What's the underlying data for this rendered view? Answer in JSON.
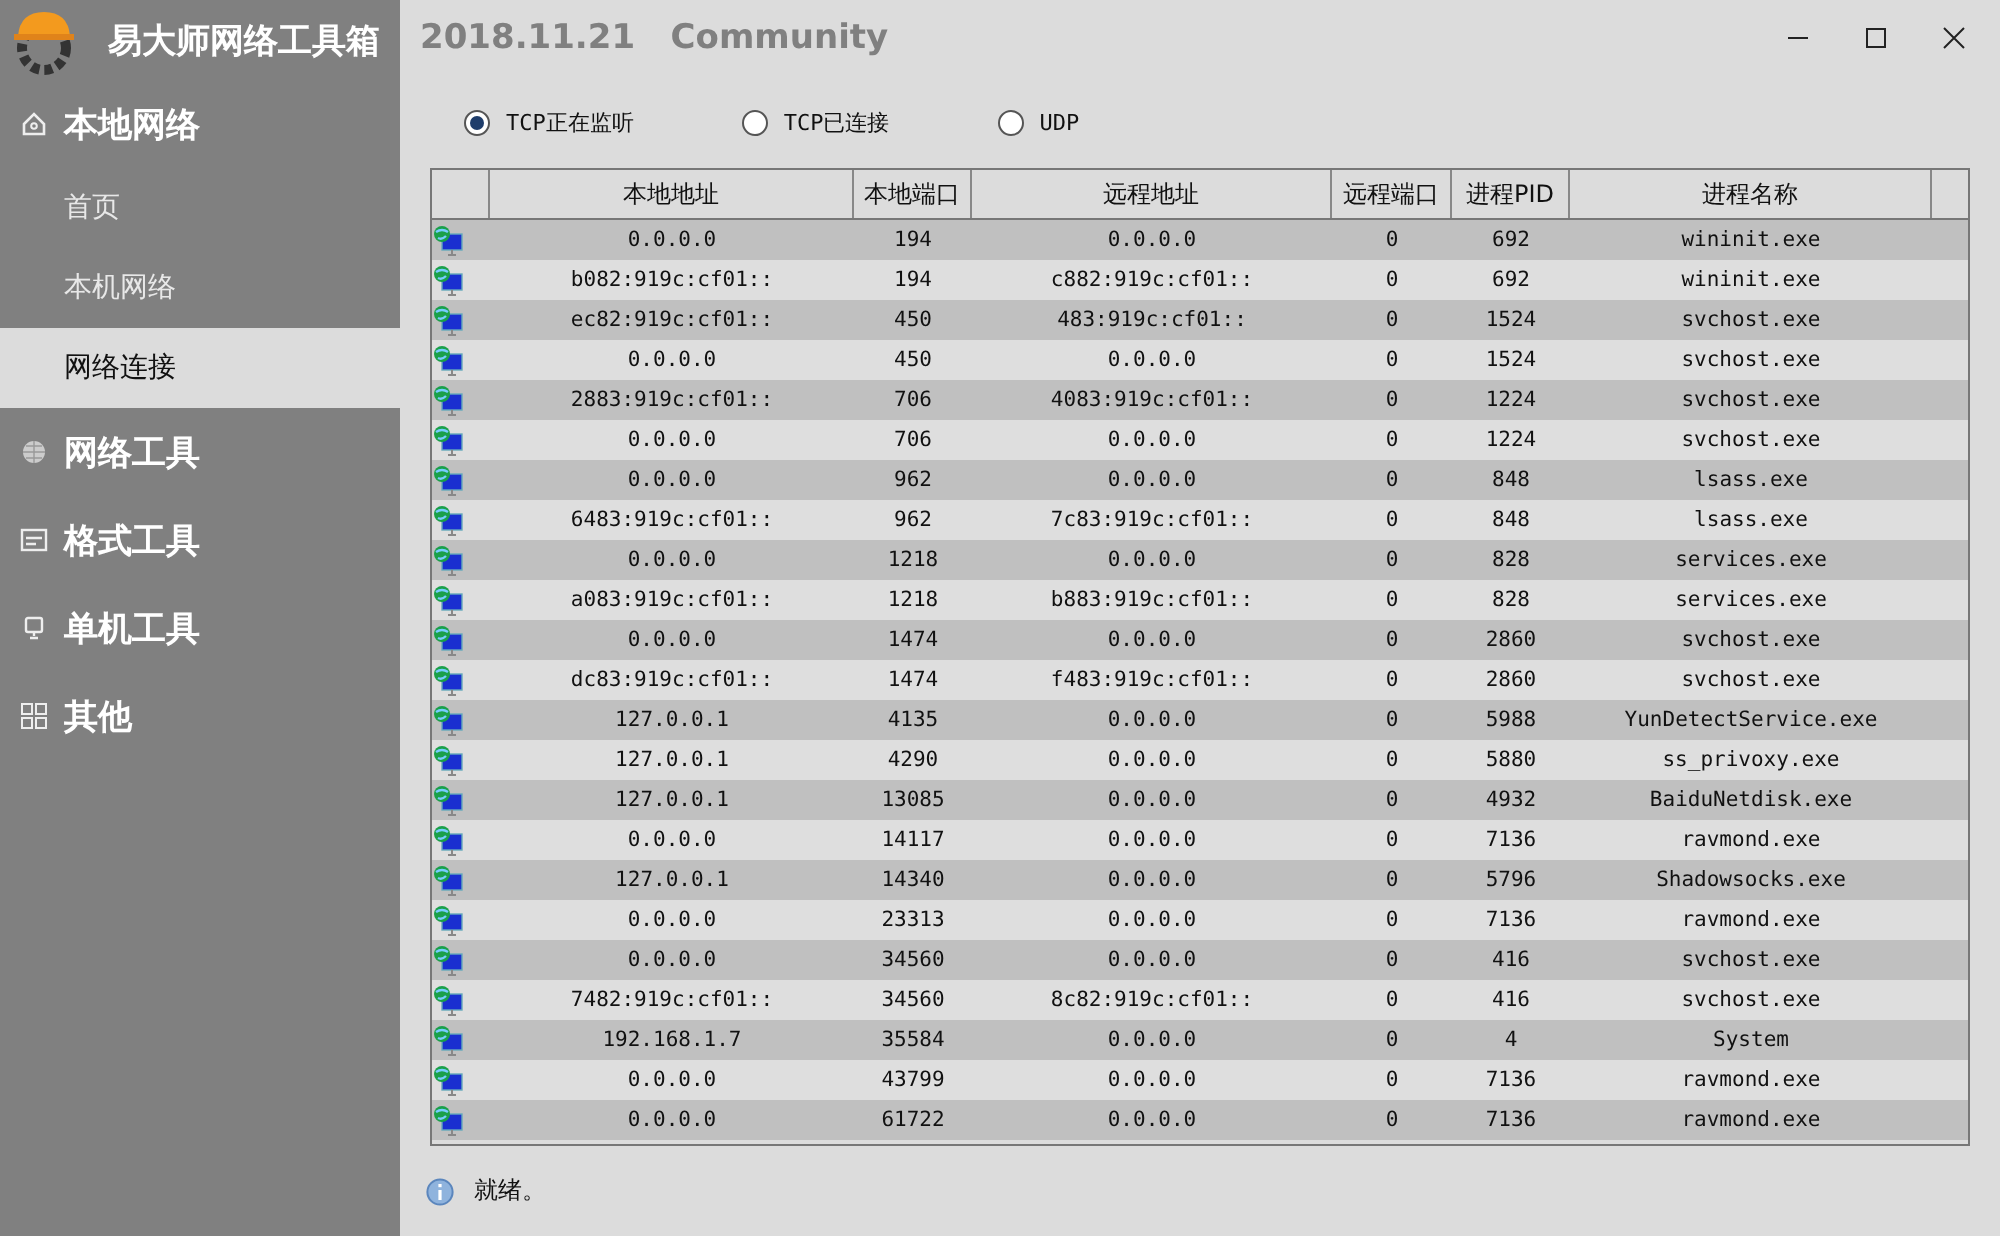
{
  "app_title": "易大师网络工具箱",
  "version_title": "2018.11.21   Community",
  "sidebar": {
    "groups": [
      {
        "label": "本地网络",
        "children": [
          {
            "label": "首页",
            "selected": false
          },
          {
            "label": "本机网络",
            "selected": false
          },
          {
            "label": "网络连接",
            "selected": true
          }
        ]
      },
      {
        "label": "网络工具"
      },
      {
        "label": "格式工具"
      },
      {
        "label": "单机工具"
      },
      {
        "label": "其他"
      }
    ]
  },
  "radios": [
    {
      "label": "TCP正在监听",
      "selected": true
    },
    {
      "label": "TCP已连接",
      "selected": false
    },
    {
      "label": "UDP",
      "selected": false
    }
  ],
  "table": {
    "columns": [
      "本地地址",
      "本地端口",
      "远程地址",
      "远程端口",
      "进程PID",
      "进程名称"
    ],
    "rows": [
      [
        "0.0.0.0",
        "194",
        "0.0.0.0",
        "0",
        "692",
        "wininit.exe"
      ],
      [
        "b082:919c:cf01::",
        "194",
        "c882:919c:cf01::",
        "0",
        "692",
        "wininit.exe"
      ],
      [
        "ec82:919c:cf01::",
        "450",
        "483:919c:cf01::",
        "0",
        "1524",
        "svchost.exe"
      ],
      [
        "0.0.0.0",
        "450",
        "0.0.0.0",
        "0",
        "1524",
        "svchost.exe"
      ],
      [
        "2883:919c:cf01::",
        "706",
        "4083:919c:cf01::",
        "0",
        "1224",
        "svchost.exe"
      ],
      [
        "0.0.0.0",
        "706",
        "0.0.0.0",
        "0",
        "1224",
        "svchost.exe"
      ],
      [
        "0.0.0.0",
        "962",
        "0.0.0.0",
        "0",
        "848",
        "lsass.exe"
      ],
      [
        "6483:919c:cf01::",
        "962",
        "7c83:919c:cf01::",
        "0",
        "848",
        "lsass.exe"
      ],
      [
        "0.0.0.0",
        "1218",
        "0.0.0.0",
        "0",
        "828",
        "services.exe"
      ],
      [
        "a083:919c:cf01::",
        "1218",
        "b883:919c:cf01::",
        "0",
        "828",
        "services.exe"
      ],
      [
        "0.0.0.0",
        "1474",
        "0.0.0.0",
        "0",
        "2860",
        "svchost.exe"
      ],
      [
        "dc83:919c:cf01::",
        "1474",
        "f483:919c:cf01::",
        "0",
        "2860",
        "svchost.exe"
      ],
      [
        "127.0.0.1",
        "4135",
        "0.0.0.0",
        "0",
        "5988",
        "YunDetectService.exe"
      ],
      [
        "127.0.0.1",
        "4290",
        "0.0.0.0",
        "0",
        "5880",
        "ss_privoxy.exe"
      ],
      [
        "127.0.0.1",
        "13085",
        "0.0.0.0",
        "0",
        "4932",
        "BaiduNetdisk.exe"
      ],
      [
        "0.0.0.0",
        "14117",
        "0.0.0.0",
        "0",
        "7136",
        "ravmond.exe"
      ],
      [
        "127.0.0.1",
        "14340",
        "0.0.0.0",
        "0",
        "5796",
        "Shadowsocks.exe"
      ],
      [
        "0.0.0.0",
        "23313",
        "0.0.0.0",
        "0",
        "7136",
        "ravmond.exe"
      ],
      [
        "0.0.0.0",
        "34560",
        "0.0.0.0",
        "0",
        "416",
        "svchost.exe"
      ],
      [
        "7482:919c:cf01::",
        "34560",
        "8c82:919c:cf01::",
        "0",
        "416",
        "svchost.exe"
      ],
      [
        "192.168.1.7",
        "35584",
        "0.0.0.0",
        "0",
        "4",
        "System"
      ],
      [
        "0.0.0.0",
        "43799",
        "0.0.0.0",
        "0",
        "7136",
        "ravmond.exe"
      ],
      [
        "0.0.0.0",
        "61722",
        "0.0.0.0",
        "0",
        "7136",
        "ravmond.exe"
      ]
    ]
  },
  "status_bar": "就绪。"
}
